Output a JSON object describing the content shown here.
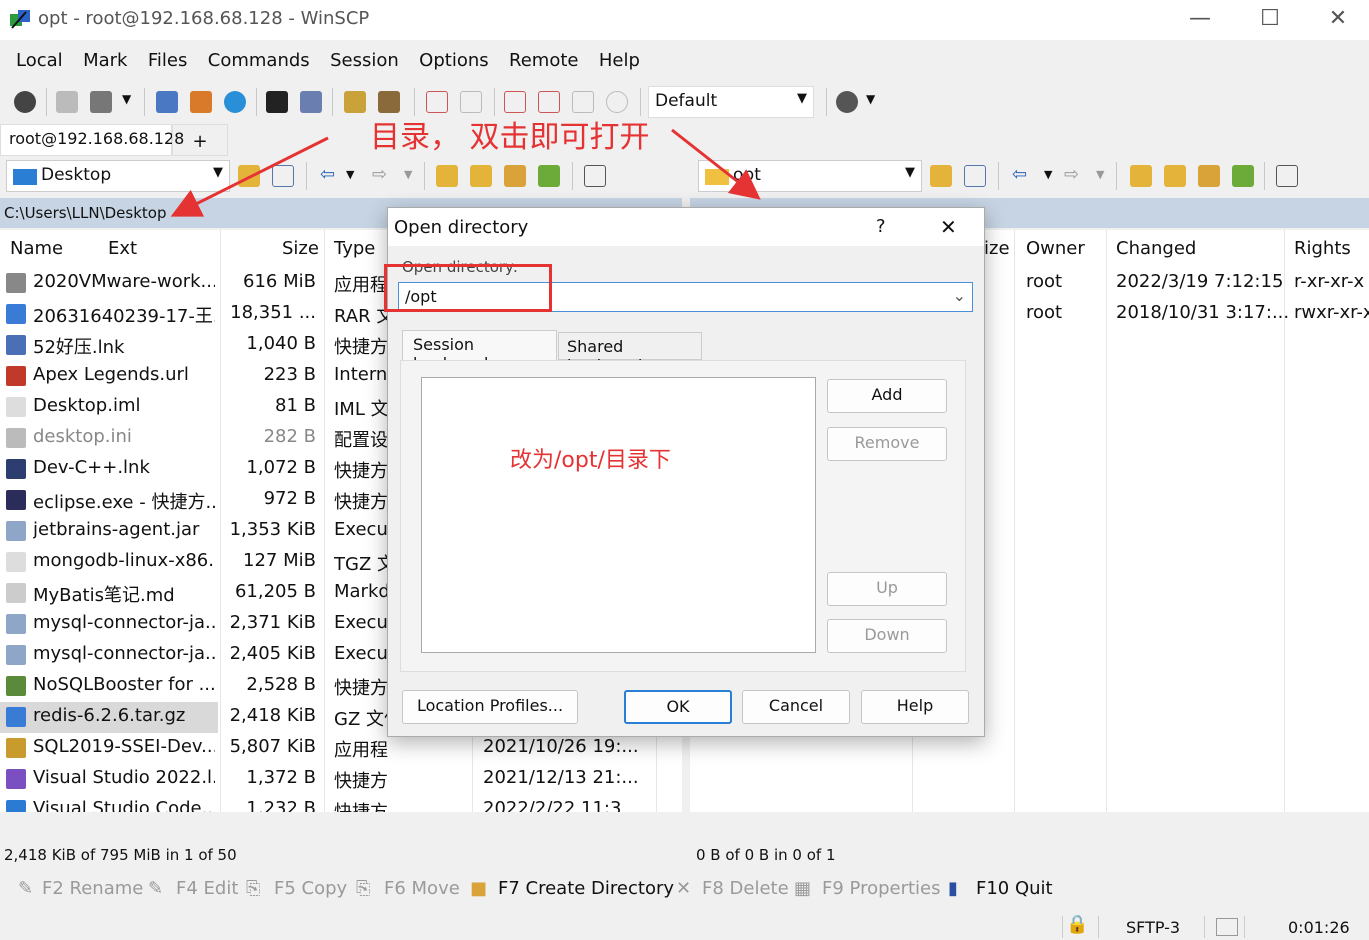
{
  "window": {
    "title": "opt - root@192.168.68.128 - WinSCP",
    "minimize": "—",
    "maximize": "☐",
    "close": "✕"
  },
  "menu": [
    "Local",
    "Mark",
    "Files",
    "Commands",
    "Session",
    "Options",
    "Remote",
    "Help"
  ],
  "toolbar": {
    "transfer_profile": "Default"
  },
  "session_tab": {
    "label": "root@192.168.68.128",
    "new_tab": "+"
  },
  "left": {
    "location": "Desktop",
    "path": "C:\\Users\\LLN\\Desktop",
    "columns": {
      "name": "Name",
      "ext": "Ext",
      "size": "Size",
      "type": "Type"
    },
    "files": [
      {
        "name": "2020VMware-work...",
        "size": "616 MiB",
        "type": "应用程",
        "color": "#888888"
      },
      {
        "name": "20631640239-17-王...",
        "size": "18,351 ...",
        "type": "RAR 文",
        "color": "#3a7bd5"
      },
      {
        "name": "52好压.lnk",
        "size": "1,040 B",
        "type": "快捷方",
        "color": "#4a6fb5"
      },
      {
        "name": "Apex Legends.url",
        "size": "223 B",
        "type": "Interne",
        "color": "#c0392b"
      },
      {
        "name": "Desktop.iml",
        "size": "81 B",
        "type": "IML 文",
        "color": "#dddddd"
      },
      {
        "name": "desktop.ini",
        "size": "282 B",
        "type": "配置设",
        "color": "#bbbbbb",
        "dim": true
      },
      {
        "name": "Dev-C++.lnk",
        "size": "1,072 B",
        "type": "快捷方",
        "color": "#2c3e70"
      },
      {
        "name": "eclipse.exe - 快捷方...",
        "size": "972 B",
        "type": "快捷方",
        "color": "#2c2c5a"
      },
      {
        "name": "jetbrains-agent.jar",
        "size": "1,353 KiB",
        "type": "Execut",
        "color": "#8fa6c9"
      },
      {
        "name": "mongodb-linux-x86...",
        "size": "127 MiB",
        "type": "TGZ 文",
        "color": "#dddddd"
      },
      {
        "name": "MyBatis笔记.md",
        "size": "61,205 B",
        "type": "Markd",
        "color": "#cccccc"
      },
      {
        "name": "mysql-connector-ja...",
        "size": "2,371 KiB",
        "type": "Execut",
        "color": "#8fa6c9"
      },
      {
        "name": "mysql-connector-ja...",
        "size": "2,405 KiB",
        "type": "Execut",
        "color": "#8fa6c9"
      },
      {
        "name": "NoSQLBooster for ...",
        "size": "2,528 B",
        "type": "快捷方",
        "color": "#5a8a3a"
      },
      {
        "name": "redis-6.2.6.tar.gz",
        "size": "2,418 KiB",
        "type": "GZ 文件",
        "color": "#3a7bd5",
        "selected": true
      },
      {
        "name": "SQL2019-SSEI-Dev....",
        "size": "5,807 KiB",
        "type": "应用程序",
        "date": "2021/10/26  19:...",
        "color": "#c89b2c"
      },
      {
        "name": "Visual Studio 2022.l...",
        "size": "1,372 B",
        "type": "快捷方式",
        "date": "2021/12/13  21:...",
        "color": "#7b4fc2"
      },
      {
        "name": "Visual Studio Code...",
        "size": "1,232 B",
        "type": "快捷方式",
        "date": "2022/2/22  11:3",
        "color": "#2b7bd5"
      }
    ],
    "status": "2,418 KiB of 795 MiB in 1 of 50"
  },
  "right": {
    "location": "opt",
    "columns": {
      "size": "ize",
      "owner": "Owner",
      "changed": "Changed",
      "rights": "Rights"
    },
    "files": [
      {
        "owner": "root",
        "changed": "2022/3/19 7:12:15",
        "rights": "r-xr-xr-x"
      },
      {
        "owner": "root",
        "changed": "2018/10/31 3:17:...",
        "rights": "rwxr-xr-x"
      }
    ],
    "status": "0 B of 0 B in 0 of 1"
  },
  "fnkeys": [
    "F2 Rename",
    "F4 Edit",
    "F5 Copy",
    "F6 Move",
    "F7 Create Directory",
    "F8 Delete",
    "F9 Properties",
    "F10 Quit"
  ],
  "bottom": {
    "protocol": "SFTP-3",
    "time": "0:01:26"
  },
  "dialog": {
    "title": "Open directory",
    "help_glyph": "?",
    "close_glyph": "✕",
    "label": "Open directory:",
    "path_value": "/opt",
    "tabs": [
      "Session bookmarks",
      "Shared bookmarks"
    ],
    "buttons": {
      "add": "Add",
      "remove": "Remove",
      "up": "Up",
      "down": "Down",
      "location_profiles": "Location Profiles...",
      "ok": "OK",
      "cancel": "Cancel",
      "help": "Help"
    }
  },
  "annotations": {
    "top": "目录， 双击即可打开",
    "dialog": "改为/opt/目录下"
  }
}
